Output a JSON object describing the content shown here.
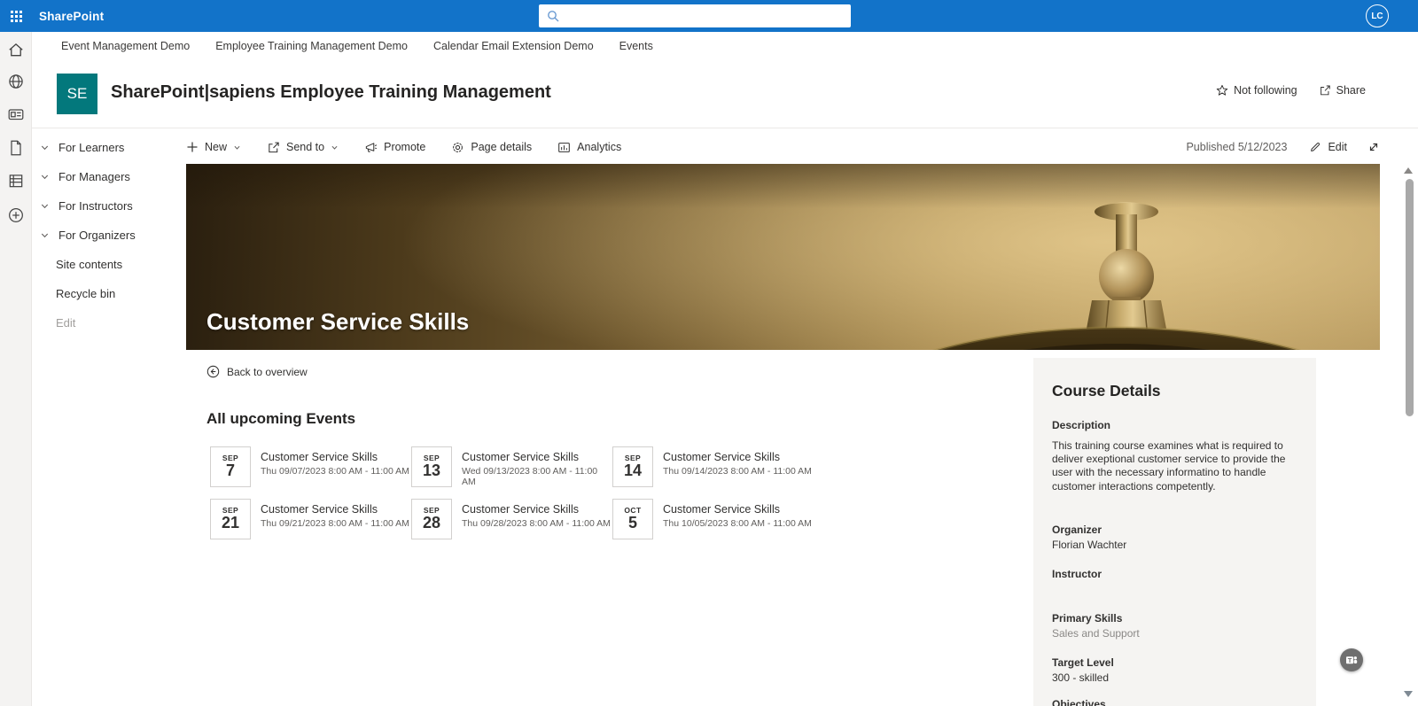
{
  "suite_bar": {
    "app_name": "SharePoint",
    "search_placeholder": "",
    "avatar_initials": "LC"
  },
  "hub_nav": {
    "items": [
      "Event Management Demo",
      "Employee Training Management Demo",
      "Calendar Email Extension Demo",
      "Events"
    ]
  },
  "site_header": {
    "logo_text": "SE",
    "title": "SharePoint|sapiens Employee Training Management",
    "follow_label": "Not following",
    "share_label": "Share"
  },
  "sidebar": {
    "groups": [
      {
        "label": "For Learners"
      },
      {
        "label": "For Managers"
      },
      {
        "label": "For Instructors"
      },
      {
        "label": "For Organizers"
      }
    ],
    "links": [
      "Site contents",
      "Recycle bin"
    ],
    "edit_label": "Edit"
  },
  "command_bar": {
    "new_label": "New",
    "send_to_label": "Send to",
    "promote_label": "Promote",
    "page_details_label": "Page details",
    "analytics_label": "Analytics",
    "published": "Published 5/12/2023",
    "edit_label": "Edit"
  },
  "hero": {
    "title": "Customer Service Skills"
  },
  "content": {
    "back_link": "Back to overview",
    "events_heading": "All upcoming Events",
    "events": [
      {
        "month": "SEP",
        "day": "7",
        "title": "Customer Service Skills",
        "datetime": "Thu 09/07/2023 8:00 AM - 11:00 AM"
      },
      {
        "month": "SEP",
        "day": "13",
        "title": "Customer Service Skills",
        "datetime": "Wed 09/13/2023 8:00 AM - 11:00 AM"
      },
      {
        "month": "SEP",
        "day": "14",
        "title": "Customer Service Skills",
        "datetime": "Thu 09/14/2023 8:00 AM - 11:00 AM"
      },
      {
        "month": "SEP",
        "day": "21",
        "title": "Customer Service Skills",
        "datetime": "Thu 09/21/2023 8:00 AM - 11:00 AM"
      },
      {
        "month": "SEP",
        "day": "28",
        "title": "Customer Service Skills",
        "datetime": "Thu 09/28/2023 8:00 AM - 11:00 AM"
      },
      {
        "month": "OCT",
        "day": "5",
        "title": "Customer Service Skills",
        "datetime": "Thu 10/05/2023 8:00 AM - 11:00 AM"
      }
    ]
  },
  "course_details": {
    "heading": "Course Details",
    "description_label": "Description",
    "description": "This training course examines what is required to deliver exeptional customer service to provide the user with the necessary informatino to handle customer interactions competently.",
    "organizer_label": "Organizer",
    "organizer": "Florian Wachter",
    "instructor_label": "Instructor",
    "instructor": "",
    "primary_skills_label": "Primary Skills",
    "primary_skills": "Sales and Support",
    "target_level_label": "Target Level",
    "target_level": "300 - skilled",
    "objectives_label": "Objectives"
  },
  "icons": {
    "waffle": "app-launcher",
    "search": "magnifier",
    "star": "not-following",
    "share": "share-box-arrow",
    "rail": [
      "home",
      "globe",
      "news-card",
      "page",
      "library-stack",
      "add-circle"
    ],
    "commands": [
      "plus",
      "send-share",
      "megaphone",
      "gear",
      "bar-chart",
      "pencil",
      "expand-diagonal"
    ],
    "back": "arrow-left-circle",
    "fab": "teams"
  },
  "colors": {
    "suite_bar": "#1273c9",
    "logo_bg": "#03787c",
    "text_primary": "#323130",
    "text_muted": "#605e5c",
    "hero_gold": "#bd9f62",
    "panel_bg": "#f5f4f2"
  }
}
